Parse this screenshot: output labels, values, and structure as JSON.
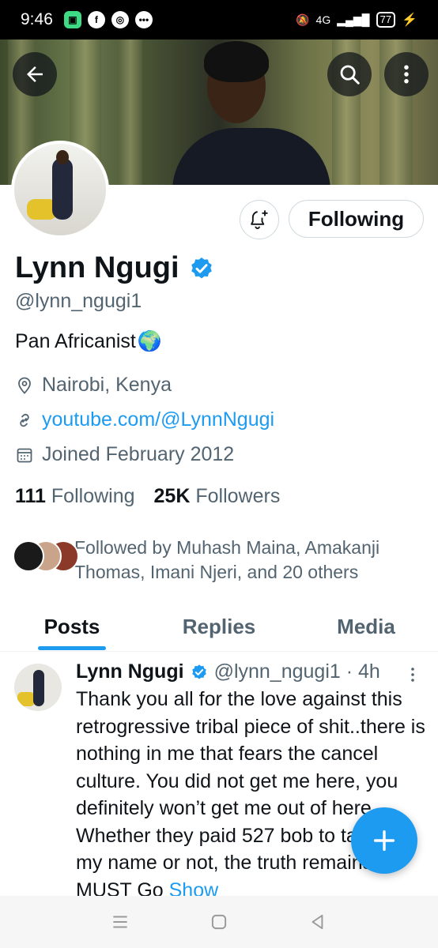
{
  "status_bar": {
    "time": "9:46",
    "network": "4G",
    "battery": "77",
    "apps": [
      "messages-icon",
      "facebook-icon",
      "chrome-icon",
      "chat-icon"
    ]
  },
  "header": {
    "back_icon": "arrow-left-icon",
    "search_icon": "search-icon",
    "more_icon": "more-vertical-icon"
  },
  "profile": {
    "name": "Lynn Ngugi",
    "verified": true,
    "handle": "@lynn_ngugi1",
    "bio": "Pan Africanist",
    "bio_emoji": "🌍",
    "location": "Nairobi, Kenya",
    "website": "youtube.com/@LynnNgugi",
    "joined": "Joined February 2012",
    "following_count": "111",
    "following_label": "Following",
    "followers_count": "25K",
    "followers_label": "Followers",
    "followed_by": "Followed by Muhash Maina, Amakanji Thomas, Imani Njeri, and 20 others",
    "follow_button_label": "Following"
  },
  "tabs": [
    {
      "label": "Posts",
      "active": true
    },
    {
      "label": "Replies",
      "active": false
    },
    {
      "label": "Media",
      "active": false
    }
  ],
  "post": {
    "author": "Lynn Ngugi",
    "handle_time": "@lynn_ngugi1 · 4h",
    "text": "Thank you all for the love against this retrogressive tribal piece of shit..there is nothing in me that fears the cancel culture. You did not get me here, you definitely won’t get me out of here. Whether they paid 527 bob to tarnish my name or not, the truth remains, MUST Go",
    "show_more": "Show"
  },
  "colors": {
    "accent": "#1d9bf0",
    "text": "#0f1419",
    "muted": "#536471"
  }
}
